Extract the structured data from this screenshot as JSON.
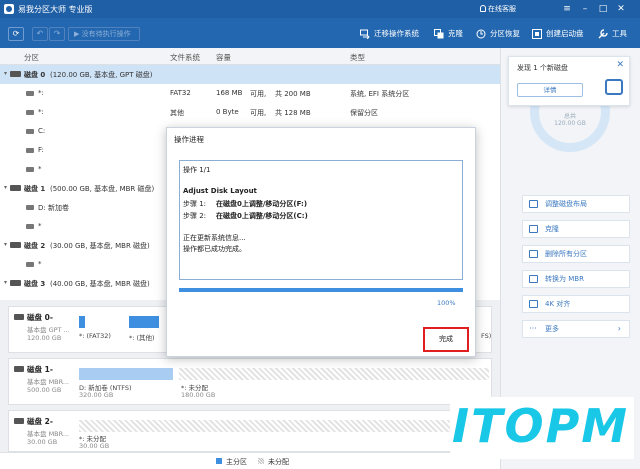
{
  "window": {
    "title": "易我分区大师 专业版",
    "license": "在线客服"
  },
  "toolbar": {
    "refresh_label": "⟳",
    "undo_label": "↶",
    "redo_label": "↷",
    "pending_label": "没有待执行操作",
    "items": [
      {
        "label": "迁移操作系统",
        "icon": "migrate-icon"
      },
      {
        "label": "克隆",
        "icon": "clone-icon"
      },
      {
        "label": "分区恢复",
        "icon": "recover-icon"
      },
      {
        "label": "创建启动盘",
        "icon": "bootdisk-icon"
      },
      {
        "label": "工具",
        "icon": "tools-icon"
      }
    ]
  },
  "columns": {
    "partition": "分区",
    "fs": "文件系统",
    "capacity": "容量",
    "type": "类型"
  },
  "disks_list": [
    {
      "kind": "disk",
      "label": "磁盘 0",
      "detail": "(120.00 GB, 基本盘, GPT 磁盘)",
      "selected": true
    },
    {
      "kind": "part",
      "label": "*:",
      "fs": "FAT32",
      "cap": "168 MB",
      "avail": "可用,",
      "free": "共  200 MB",
      "type": "系统, EFI 系统分区"
    },
    {
      "kind": "part",
      "label": "*:",
      "fs": "其他",
      "cap": "0 Byte",
      "avail": "可用,",
      "free": "共  128 MB",
      "type": "保留分区"
    },
    {
      "kind": "part",
      "label": "C:"
    },
    {
      "kind": "part",
      "label": "F:"
    },
    {
      "kind": "part",
      "label": "*"
    },
    {
      "kind": "disk",
      "label": "磁盘 1",
      "detail": "(500.00 GB, 基本盘, MBR 磁盘)"
    },
    {
      "kind": "part",
      "label": "D: 新加卷"
    },
    {
      "kind": "part",
      "label": "*"
    },
    {
      "kind": "disk",
      "label": "磁盘 2",
      "detail": "(30.00 GB, 基本盘, MBR 磁盘)"
    },
    {
      "kind": "part",
      "label": "*"
    },
    {
      "kind": "disk",
      "label": "磁盘 3",
      "detail": "(40.00 GB, 基本盘, MBR 磁盘)"
    }
  ],
  "map": {
    "disk0": {
      "name": "磁盘 0-",
      "type": "基本盘 GPT ...",
      "size": "120.00 GB",
      "p1": "*: (FAT32)",
      "p2": "*: (其他)",
      "p_tail": "FS)"
    },
    "disk1": {
      "name": "磁盘 1-",
      "type": "基本盘 MBR...",
      "size": "500.00 GB",
      "p1": "D: 新加卷 (NTFS)",
      "p1_size": "320.00 GB",
      "p2": "*: 未分配",
      "p2_size": "180.00 GB"
    },
    "disk2": {
      "name": "磁盘 2-",
      "type": "基本盘 MBR...",
      "size": "30.00 GB",
      "p1": "*: 未分配",
      "p1_size": "30.00 GB"
    }
  },
  "legend": {
    "primary": "主分区",
    "unallocated": "未分配"
  },
  "right": {
    "notice_title": "发现 1 个新磁盘",
    "notice_btn": "详情",
    "ring_top": "总共",
    "ring_bottom": "120.00 GB",
    "actions": [
      "调整磁盘布局",
      "克隆",
      "删除所有分区",
      "转换为 MBR",
      "4K 对齐",
      "更多"
    ]
  },
  "modal": {
    "title": "操作进程",
    "log": {
      "step_count": "操作 1/1",
      "heading": "Adjust Disk Layout",
      "step1_label": "步骤 1:",
      "step1": "在磁盘0上调整/移动分区(F:)",
      "step2_label": "步骤 2:",
      "step2": "在磁盘0上调整/移动分区(C:)",
      "updating": "正在更新系统信息...",
      "success": "操作都已成功完成。"
    },
    "progress": 1.0,
    "percent": "100%",
    "done_button": "完成"
  },
  "watermark": "ITOPM",
  "colors": {
    "titlebar": "#1f5fa6",
    "toolbar": "#2367b0",
    "primary": "#3f8fe0",
    "highlight": "#e02020",
    "watermark": "#19c7e6"
  }
}
